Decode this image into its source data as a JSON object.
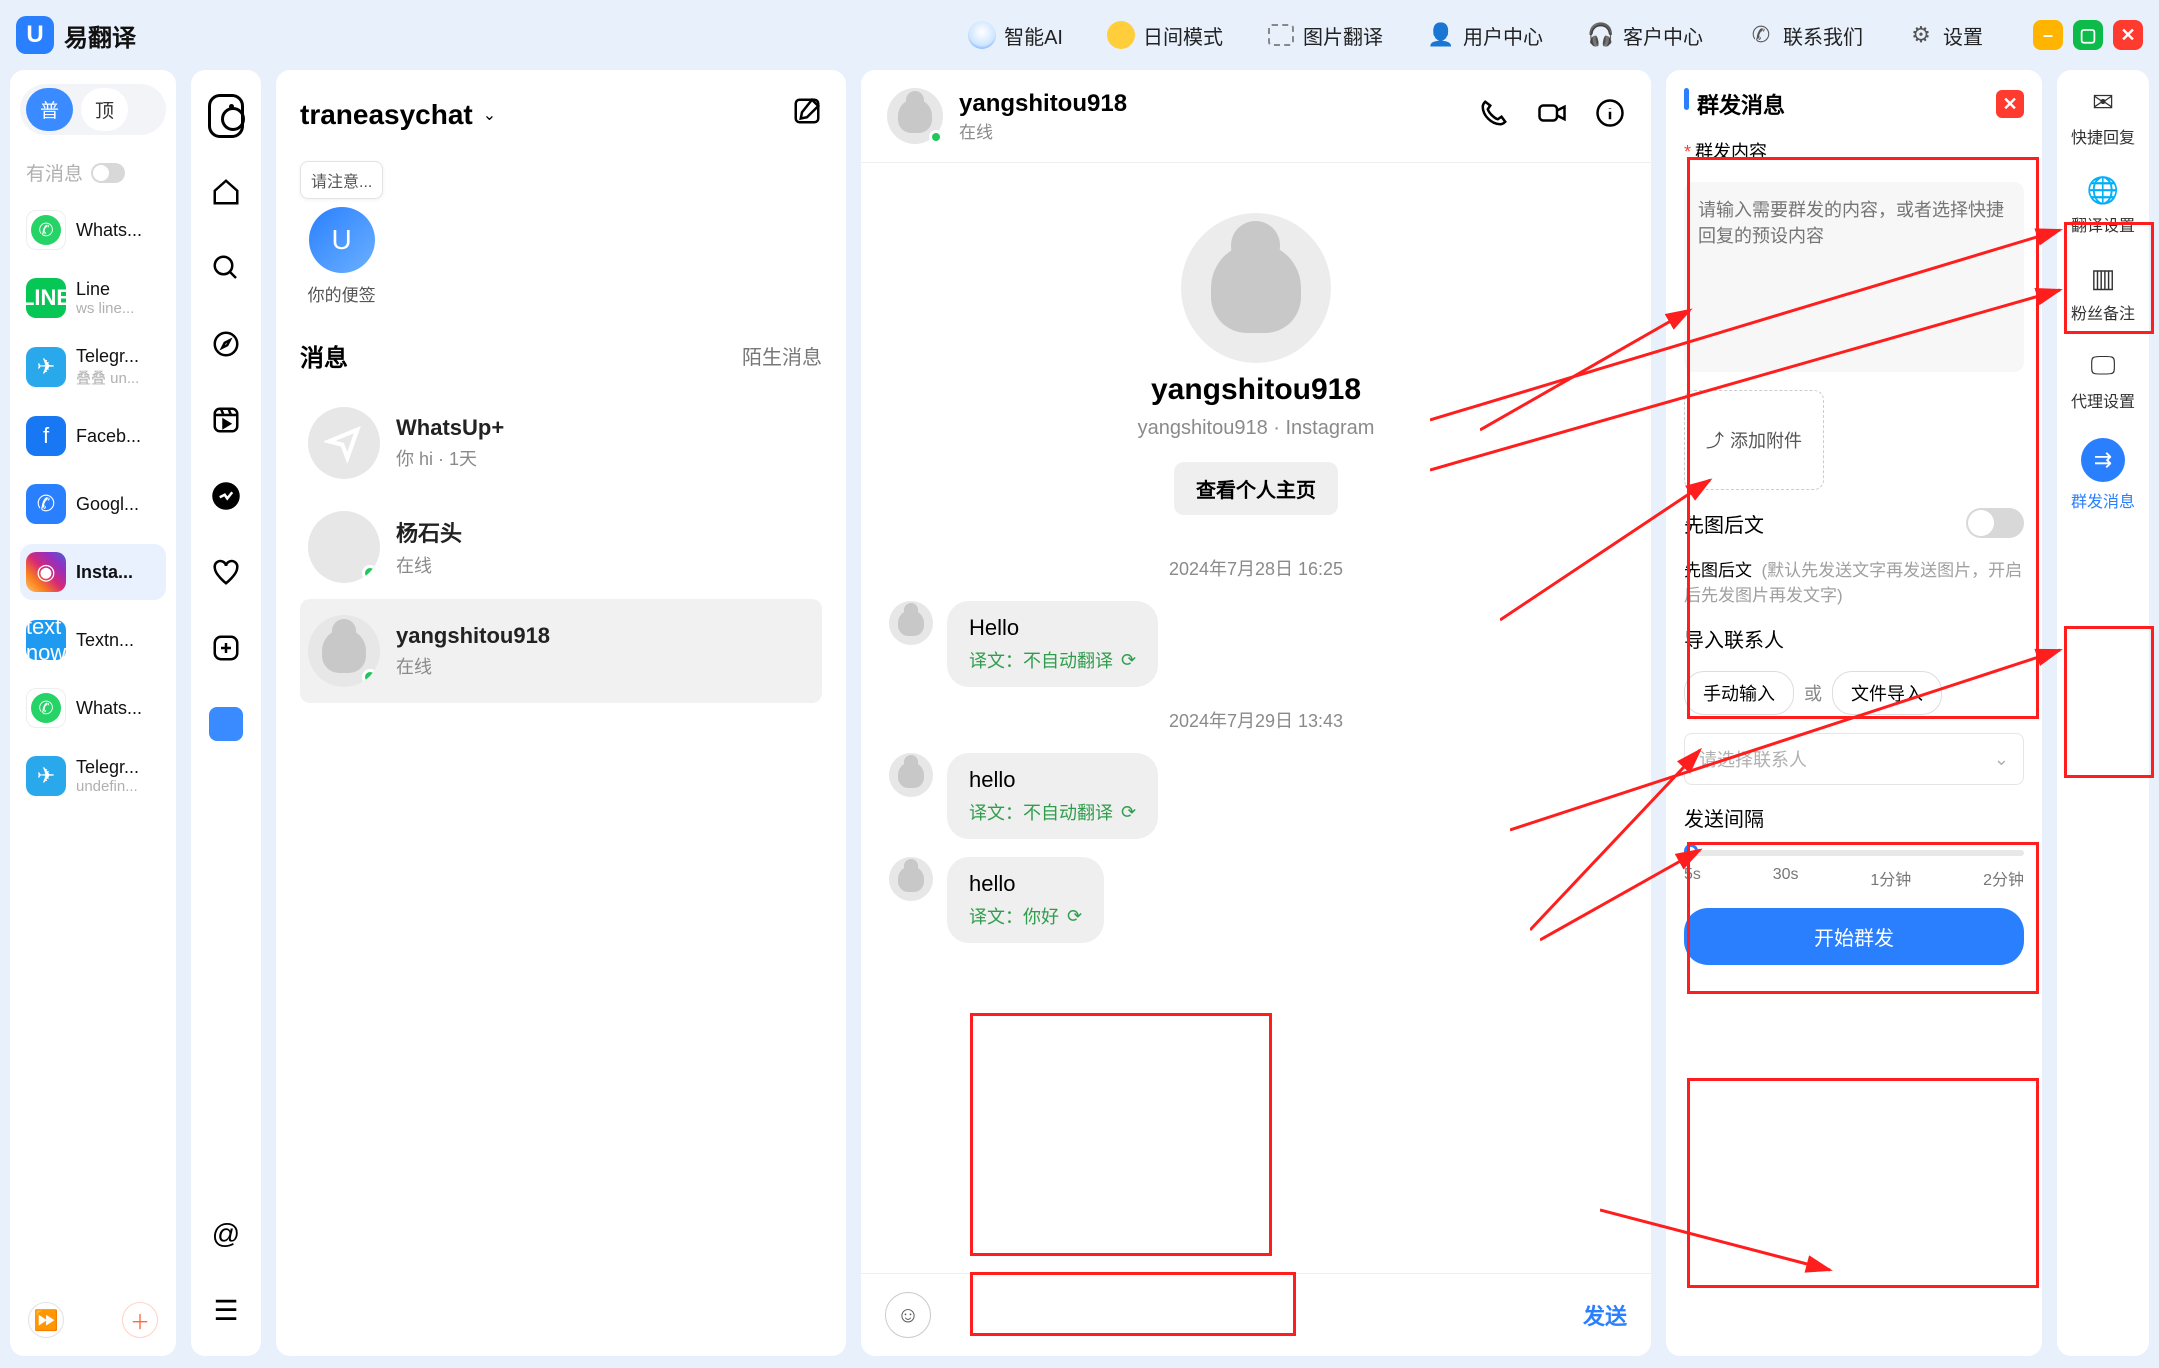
{
  "brand": {
    "name": "易翻译"
  },
  "topbar": {
    "ai": "智能AI",
    "daymode": "日间模式",
    "imgtranslate": "图片翻译",
    "usercenter": "用户中心",
    "custcenter": "客户中心",
    "contact": "联系我们",
    "settings": "设置"
  },
  "accounts": {
    "pill1": "普",
    "pill2": "顶",
    "hasMessage": "有消息",
    "items": [
      {
        "title": "Whats...",
        "sub": " "
      },
      {
        "title": "Line",
        "sub": "ws line..."
      },
      {
        "title": "Telegr...",
        "sub": "叠叠 un..."
      },
      {
        "title": "Faceb...",
        "sub": " "
      },
      {
        "title": "Googl...",
        "sub": ""
      },
      {
        "title": "Insta...",
        "sub": ""
      },
      {
        "title": "Textn...",
        "sub": ""
      },
      {
        "title": "Whats...",
        "sub": ""
      },
      {
        "title": "Telegr...",
        "sub": "undefin..."
      }
    ]
  },
  "convlist": {
    "account": "traneasychat",
    "note_tip": "请注意...",
    "note_cap": "你的便签",
    "messages_label": "消息",
    "stranger_label": "陌生消息",
    "items": [
      {
        "name": "WhatsUp+",
        "sub": "你 hi · 1天"
      },
      {
        "name": "杨石头",
        "sub": "在线"
      },
      {
        "name": "yangshitou918",
        "sub": "在线"
      }
    ]
  },
  "chat": {
    "name": "yangshitou918",
    "status": "在线",
    "profile_name": "yangshitou918",
    "profile_meta": "yangshitou918 · Instagram",
    "view_profile": "查看个人主页",
    "day1": "2024年7月28日 16:25",
    "day2": "2024年7月29日 13:43",
    "msgs": [
      {
        "text": "Hello",
        "trans": "译文：不自动翻译"
      },
      {
        "text": "hello",
        "trans": "译文：不自动翻译"
      },
      {
        "text": "hello",
        "trans": "译文：你好"
      }
    ],
    "send": "发送"
  },
  "gs": {
    "title": "群发消息",
    "content_label": "群发内容",
    "placeholder": "请输入需要群发的内容，或者选择快捷回复的预设内容",
    "attach": "添加附件",
    "img_then_text": "先图后文",
    "img_then_text_desc": "先图后文",
    "img_then_text_help": "(默认先发送文字再发送图片，开启后先发图片再发文字)",
    "import_label": "导入联系人",
    "manual": "手动输入",
    "or": "或",
    "fileimport": "文件导入",
    "select_placeholder": "请选择联系人",
    "interval_label": "发送间隔",
    "slider": {
      "t0": "5s",
      "t1": "30s",
      "t2": "1分钟",
      "t3": "2分钟"
    },
    "start": "开始群发"
  },
  "rightrail": {
    "items": [
      "快捷回复",
      "翻译设置",
      "粉丝备注",
      "代理设置",
      "群发消息"
    ]
  }
}
